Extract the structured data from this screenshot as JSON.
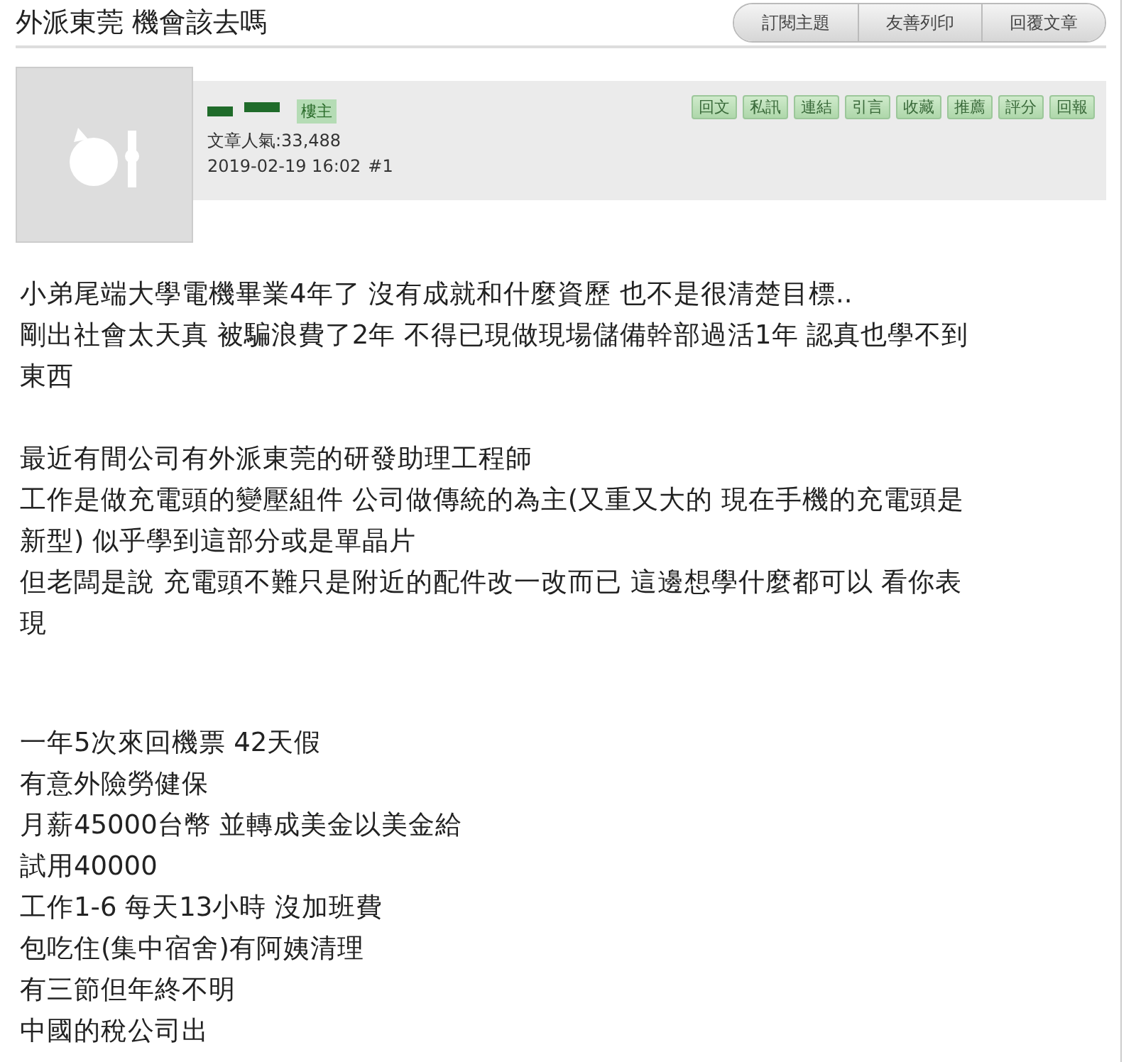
{
  "title": "外派東莞 機會該去嗎",
  "toolbar": [
    "訂閱主題",
    "友善列印",
    "回覆文章"
  ],
  "post": {
    "author_badge": "樓主",
    "popularity_label": "文章人氣:",
    "popularity": "33,488",
    "datetime": "2019-02-19 16:02",
    "floor": "#1",
    "actions": [
      "回文",
      "私訊",
      "連結",
      "引言",
      "收藏",
      "推薦",
      "評分",
      "回報"
    ],
    "paragraphs": [
      {
        "lines": [
          "小弟尾端大學電機畢業4年了 沒有成就和什麼資歷 也不是很清楚目標..",
          "剛出社會太天真 被騙浪費了2年 不得已現做現場儲備幹部過活1年 認真也學不到",
          "東西"
        ]
      },
      {
        "lines": [
          "最近有間公司有外派東莞的研發助理工程師",
          "工作是做充電頭的變壓組件 公司做傳統的為主(又重又大的 現在手機的充電頭是",
          "新型) 似乎學到這部分或是單晶片",
          "但老闆是說 充電頭不難只是附近的配件改一改而已 這邊想學什麼都可以 看你表",
          "現"
        ]
      },
      {
        "lines": [
          "一年5次來回機票 42天假",
          "有意外險勞健保",
          "月薪45000台幣 並轉成美金以美金給",
          "試用40000",
          "工作1-6 每天13小時 沒加班費",
          "包吃住(集中宿舍)有阿姨清理",
          "有三節但年終不明",
          "中國的稅公司出"
        ]
      }
    ]
  }
}
